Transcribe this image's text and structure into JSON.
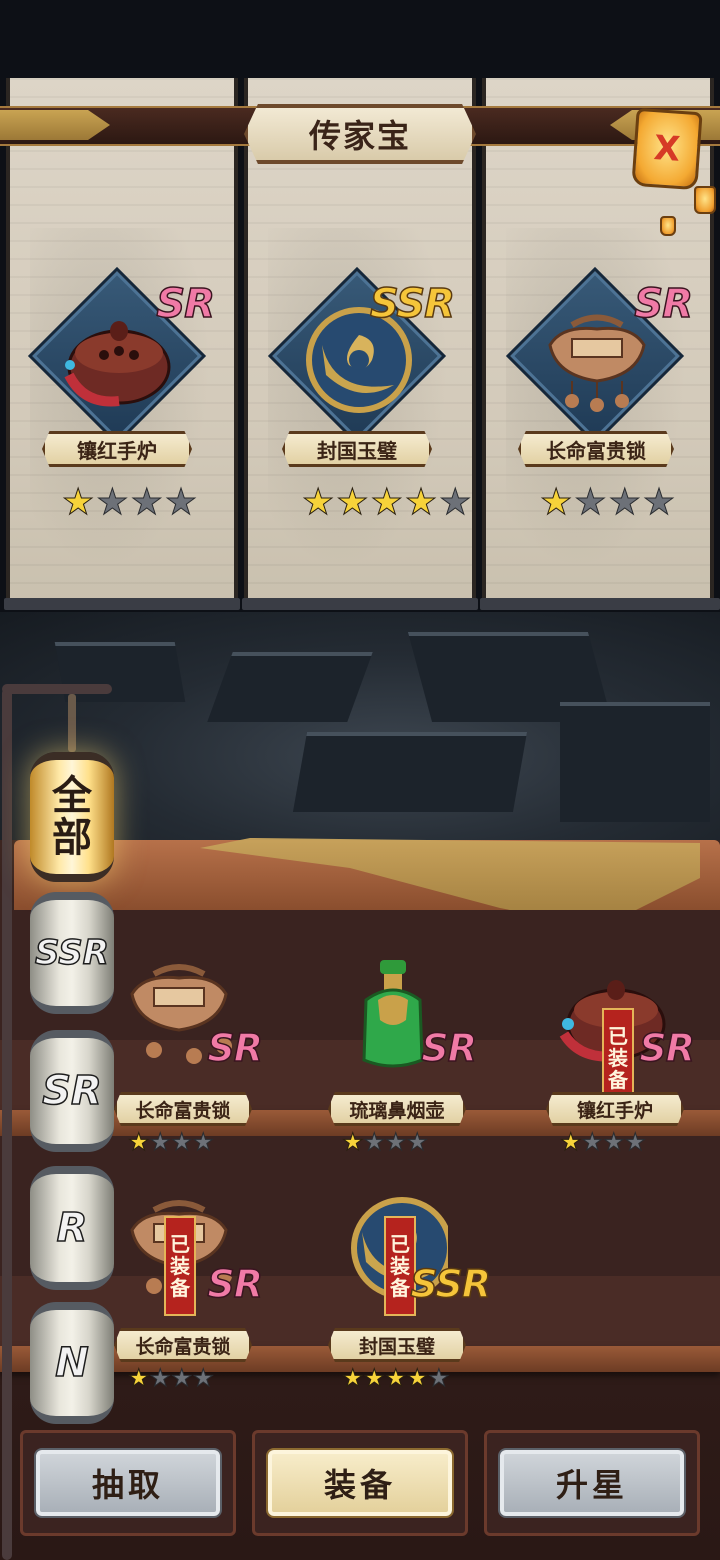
{
  "title": "传家宝",
  "close_label": "X",
  "featured": [
    {
      "name": "镶红手炉",
      "rarity": "SR",
      "stars": "★★★★",
      "stars_on": 1,
      "stars_total": 4,
      "icon": "hand-warmer-icon"
    },
    {
      "name": "封国玉璧",
      "rarity": "SSR",
      "stars": "★★★★★",
      "stars_on": 4,
      "stars_total": 5,
      "icon": "jade-disc-icon"
    },
    {
      "name": "长命富贵锁",
      "rarity": "SR",
      "stars": "★★★★",
      "stars_on": 1,
      "stars_total": 4,
      "icon": "longevity-lock-icon"
    }
  ],
  "tabs": [
    {
      "label": "全\n部",
      "active": true
    },
    {
      "label": "SSR",
      "active": false
    },
    {
      "label": "SR",
      "active": false
    },
    {
      "label": "R",
      "active": false
    },
    {
      "label": "N",
      "active": false
    }
  ],
  "inventory": [
    {
      "name": "长命富贵锁",
      "rarity": "SR",
      "stars_on": 1,
      "stars_total": 4,
      "equipped": false,
      "icon": "longevity-lock-icon"
    },
    {
      "name": "琉璃鼻烟壶",
      "rarity": "SR",
      "stars_on": 1,
      "stars_total": 4,
      "equipped": false,
      "icon": "snuff-bottle-icon"
    },
    {
      "name": "镶红手炉",
      "rarity": "SR",
      "stars_on": 1,
      "stars_total": 4,
      "equipped": true,
      "icon": "hand-warmer-icon"
    },
    {
      "name": "长命富贵锁",
      "rarity": "SR",
      "stars_on": 1,
      "stars_total": 4,
      "equipped": true,
      "icon": "longevity-lock-icon"
    },
    {
      "name": "封国玉璧",
      "rarity": "SSR",
      "stars_on": 4,
      "stars_total": 5,
      "equipped": true,
      "icon": "jade-disc-icon"
    }
  ],
  "equipped_label": "已\n装\n备",
  "buttons": {
    "draw": "抽取",
    "equip": "装备",
    "upgrade": "升星"
  },
  "active_button": "equip",
  "colors": {
    "sr": "#f07aa6",
    "ssr": "#f5c53a",
    "star_on": "#f7d33a",
    "star_off": "#6d7178",
    "equipped_tag": "#b5231e"
  }
}
